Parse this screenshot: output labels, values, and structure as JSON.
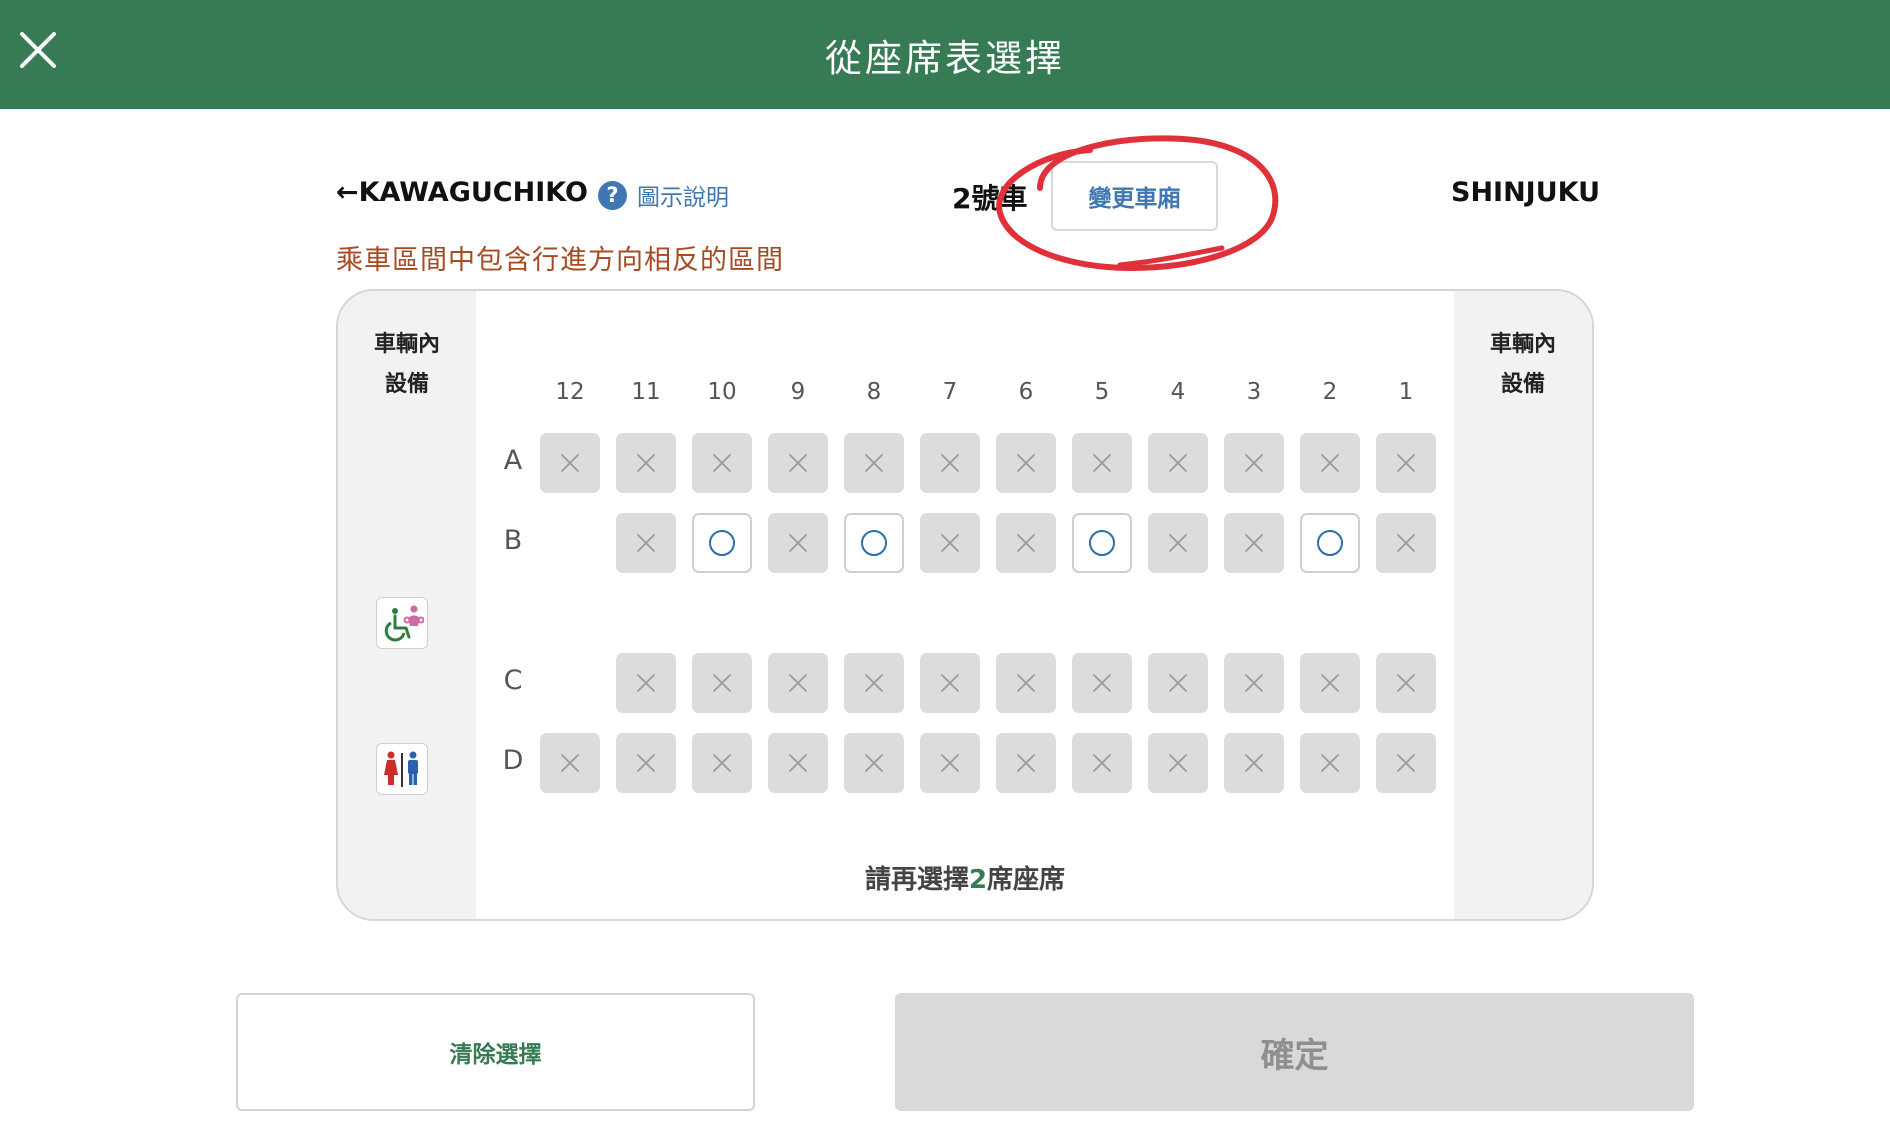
{
  "header": {
    "title": "從座席表選擇",
    "close_icon": "close-icon"
  },
  "direction": {
    "from": "←KAWAGUCHIKO",
    "to": "SHINJUKU"
  },
  "help": {
    "icon": "?",
    "label": "圖示說明"
  },
  "car": {
    "number": "2號車",
    "change_label": "變更車廂"
  },
  "warning": "乘車區間中包含行進方向相反的區間",
  "seatmap": {
    "side_title_line1": "車輌內",
    "side_title_line2": "設備",
    "columns": [
      "12",
      "11",
      "10",
      "9",
      "8",
      "7",
      "6",
      "5",
      "4",
      "3",
      "2",
      "1"
    ],
    "rows": [
      {
        "label": "A",
        "seats": [
          "x",
          "x",
          "x",
          "x",
          "x",
          "x",
          "x",
          "x",
          "x",
          "x",
          "x",
          "x"
        ]
      },
      {
        "label": "B",
        "seats": [
          "",
          "x",
          "o",
          "x",
          "o",
          "x",
          "x",
          "o",
          "x",
          "x",
          "o",
          "x"
        ]
      },
      {
        "label": "C",
        "seats": [
          "",
          "x",
          "x",
          "x",
          "x",
          "x",
          "x",
          "x",
          "x",
          "x",
          "x",
          "x"
        ]
      },
      {
        "label": "D",
        "seats": [
          "x",
          "x",
          "x",
          "x",
          "x",
          "x",
          "x",
          "x",
          "x",
          "x",
          "x",
          "x"
        ]
      }
    ],
    "facilities": [
      "wheelchair-icon",
      "restroom-icon"
    ],
    "remaining_prefix": "請再選擇",
    "remaining_count": "2",
    "remaining_suffix": "席座席"
  },
  "footer": {
    "clear_label": "清除選擇",
    "confirm_label": "確定"
  },
  "colors": {
    "brand_green": "#377b55",
    "link_blue": "#3f77b3",
    "warning": "#a84a22",
    "annotation_red": "#e0303a"
  }
}
